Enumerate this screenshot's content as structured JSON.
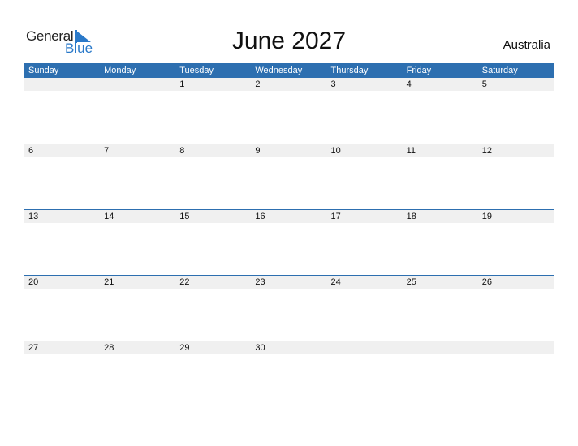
{
  "logo": {
    "text_top": "General",
    "text_bottom": "Blue"
  },
  "title": "June 2027",
  "country": "Australia",
  "colors": {
    "accent": "#2d6fb0",
    "date_strip": "#f0f0f0",
    "logo_blue": "#2a79c9"
  },
  "weekdays": [
    "Sunday",
    "Monday",
    "Tuesday",
    "Wednesday",
    "Thursday",
    "Friday",
    "Saturday"
  ],
  "weeks": [
    [
      "",
      "",
      "1",
      "2",
      "3",
      "4",
      "5"
    ],
    [
      "6",
      "7",
      "8",
      "9",
      "10",
      "11",
      "12"
    ],
    [
      "13",
      "14",
      "15",
      "16",
      "17",
      "18",
      "19"
    ],
    [
      "20",
      "21",
      "22",
      "23",
      "24",
      "25",
      "26"
    ],
    [
      "27",
      "28",
      "29",
      "30",
      "",
      "",
      ""
    ]
  ]
}
